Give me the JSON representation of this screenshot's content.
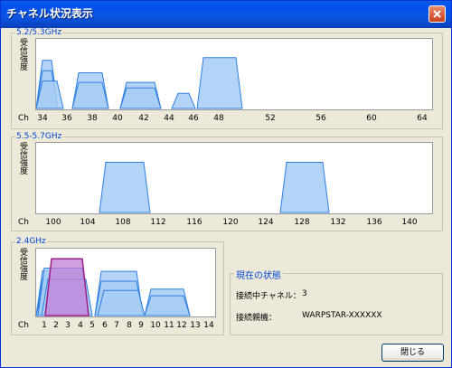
{
  "window": {
    "title": "チャネル状況表示"
  },
  "signal_label": [
    "受",
    "信",
    "強",
    "度"
  ],
  "channel_prefix": "Ch",
  "panels": [
    {
      "key": "p1",
      "label": "5.2/5.3GHz",
      "ticks": [
        "34",
        "36",
        "38",
        "40",
        "42",
        "44",
        "46",
        "48",
        "52",
        "56",
        "60",
        "64"
      ],
      "bars": [
        {
          "from": 0,
          "to": 24,
          "level": 0.7,
          "highlight": false
        },
        {
          "from": 0,
          "to": 24,
          "level": 0.55,
          "highlight": false
        },
        {
          "from": 0,
          "to": 30,
          "level": 0.4,
          "highlight": false
        },
        {
          "from": 40,
          "to": 80,
          "level": 0.52,
          "highlight": false
        },
        {
          "from": 40,
          "to": 80,
          "level": 0.38,
          "highlight": false
        },
        {
          "from": 93,
          "to": 138,
          "level": 0.38,
          "highlight": false
        },
        {
          "from": 93,
          "to": 138,
          "level": 0.3,
          "highlight": false
        },
        {
          "from": 150,
          "to": 176,
          "level": 0.22,
          "highlight": false
        },
        {
          "from": 178,
          "to": 228,
          "level": 0.74,
          "highlight": false
        }
      ]
    },
    {
      "key": "p2",
      "label": "5.5-5.7GHz",
      "ticks": [
        "100",
        "104",
        "108",
        "112",
        "116",
        "120",
        "124",
        "128",
        "132",
        "136",
        "140"
      ],
      "bars": [
        {
          "from": 70,
          "to": 126,
          "level": 0.73,
          "highlight": false
        },
        {
          "from": 270,
          "to": 324,
          "level": 0.73,
          "highlight": false
        }
      ]
    },
    {
      "key": "p3",
      "label": "2.4GHz",
      "ticks": [
        "1",
        "2",
        "3",
        "4",
        "5",
        "6",
        "7",
        "8",
        "9",
        "10",
        "11",
        "12",
        "13",
        "14"
      ],
      "bars": [
        {
          "from": 0,
          "to": 20,
          "level": 0.68,
          "highlight": false
        },
        {
          "from": 0,
          "to": 25,
          "level": 0.55,
          "highlight": false
        },
        {
          "from": 0,
          "to": 28,
          "level": 0.4,
          "highlight": false
        },
        {
          "from": 2,
          "to": 58,
          "level": 0.72,
          "highlight": false
        },
        {
          "from": 6,
          "to": 62,
          "level": 0.55,
          "highlight": false
        },
        {
          "from": 65,
          "to": 118,
          "level": 0.67,
          "highlight": false
        },
        {
          "from": 65,
          "to": 118,
          "level": 0.52,
          "highlight": false
        },
        {
          "from": 68,
          "to": 120,
          "level": 0.38,
          "highlight": false
        },
        {
          "from": 120,
          "to": 170,
          "level": 0.4,
          "highlight": false
        },
        {
          "from": 120,
          "to": 170,
          "level": 0.3,
          "highlight": false
        },
        {
          "from": 10,
          "to": 58,
          "level": 0.86,
          "highlight": true
        }
      ]
    }
  ],
  "status": {
    "title": "現在の状態",
    "channel_label": "接続中チャネル：",
    "channel_value": "3",
    "device_label": "接続親機：",
    "device_value": "WARPSTAR-XXXXXX"
  },
  "buttons": {
    "close": "閉じる"
  },
  "colors": {
    "bar_fill": "#a6cdf5",
    "bar_stroke": "#2f7fe0",
    "highlight_fill": "#c27fd6",
    "highlight_stroke": "#9b1e86",
    "title_bar": "#0a5fe0"
  }
}
